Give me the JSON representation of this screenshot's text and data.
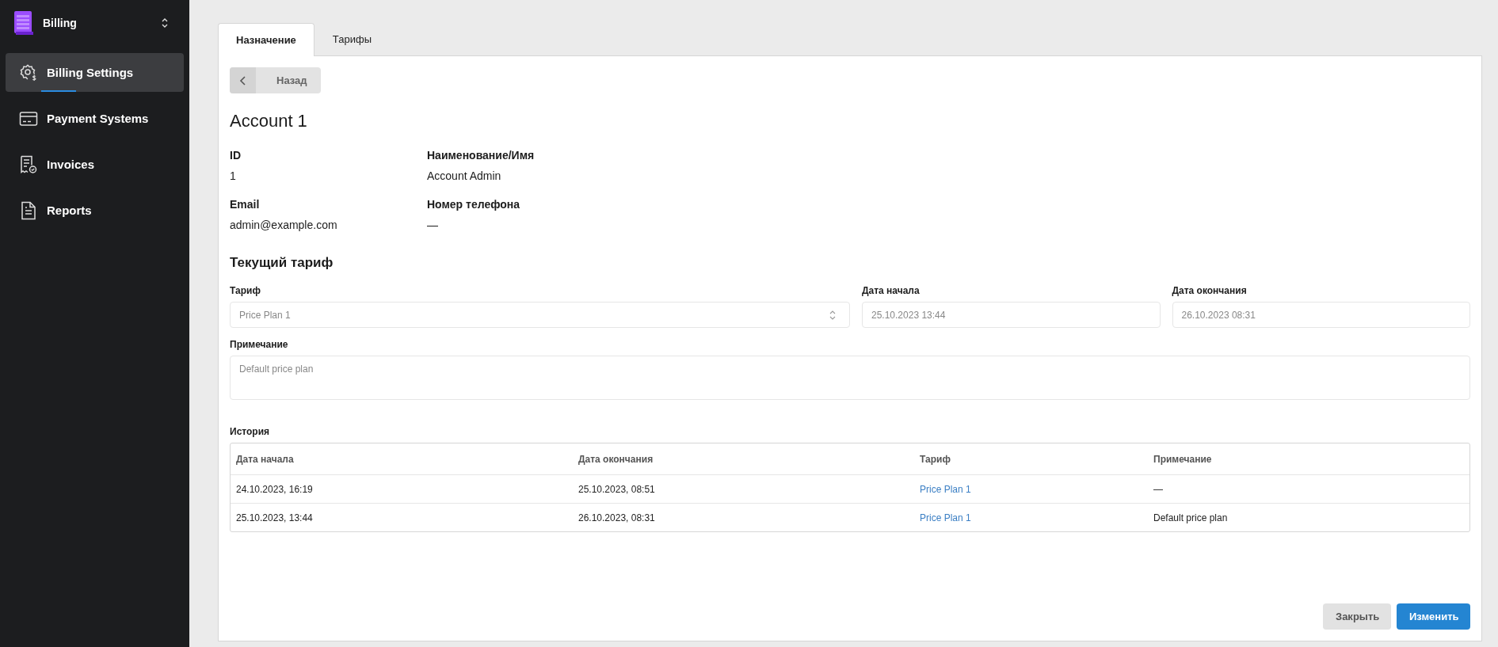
{
  "sidebar": {
    "app": {
      "title": "Billing"
    },
    "items": [
      {
        "label": "Billing Settings",
        "kind": "gear",
        "selected": true
      },
      {
        "label": "Payment Systems",
        "kind": "card",
        "selected": false
      },
      {
        "label": "Invoices",
        "kind": "invoice",
        "selected": false
      },
      {
        "label": "Reports",
        "kind": "report",
        "selected": false
      }
    ]
  },
  "tabs": [
    {
      "label": "Назначение",
      "selected": true
    },
    {
      "label": "Тарифы",
      "selected": false
    }
  ],
  "back_button": {
    "label": "Назад"
  },
  "title": "Account 1",
  "details": [
    {
      "label": "ID",
      "value": "1"
    },
    {
      "label": "Наименование/Имя",
      "value": "Account Admin"
    },
    {
      "label": "Email",
      "value": "admin@example.com"
    },
    {
      "label": "Номер телефона",
      "value": "—"
    }
  ],
  "current_plan": {
    "heading": "Текущий тариф",
    "fields": [
      {
        "label": "Тариф",
        "value": "Price Plan 1",
        "kind": "select",
        "disabled": true
      },
      {
        "label": "Дата начала",
        "value": "25.10.2023 13:44",
        "kind": "text",
        "disabled": true
      },
      {
        "label": "Дата окончания",
        "value": "26.10.2023 08:31",
        "kind": "text",
        "disabled": true
      }
    ],
    "note": {
      "label": "Примечание",
      "value": "Default price plan",
      "disabled": true
    }
  },
  "history": {
    "heading": "История",
    "columns": [
      "Дата начала",
      "Дата окончания",
      "Тариф",
      "Примечание"
    ],
    "rows": [
      [
        "24.10.2023, 16:19",
        "25.10.2023, 08:51",
        "Price Plan 1",
        "—"
      ],
      [
        "25.10.2023, 13:44",
        "26.10.2023, 08:31",
        "Price Plan 1",
        "Default price plan"
      ]
    ]
  },
  "buttons": [
    {
      "label": "Закрыть",
      "kind": "secondary"
    },
    {
      "label": "Изменить",
      "kind": "primary"
    }
  ]
}
